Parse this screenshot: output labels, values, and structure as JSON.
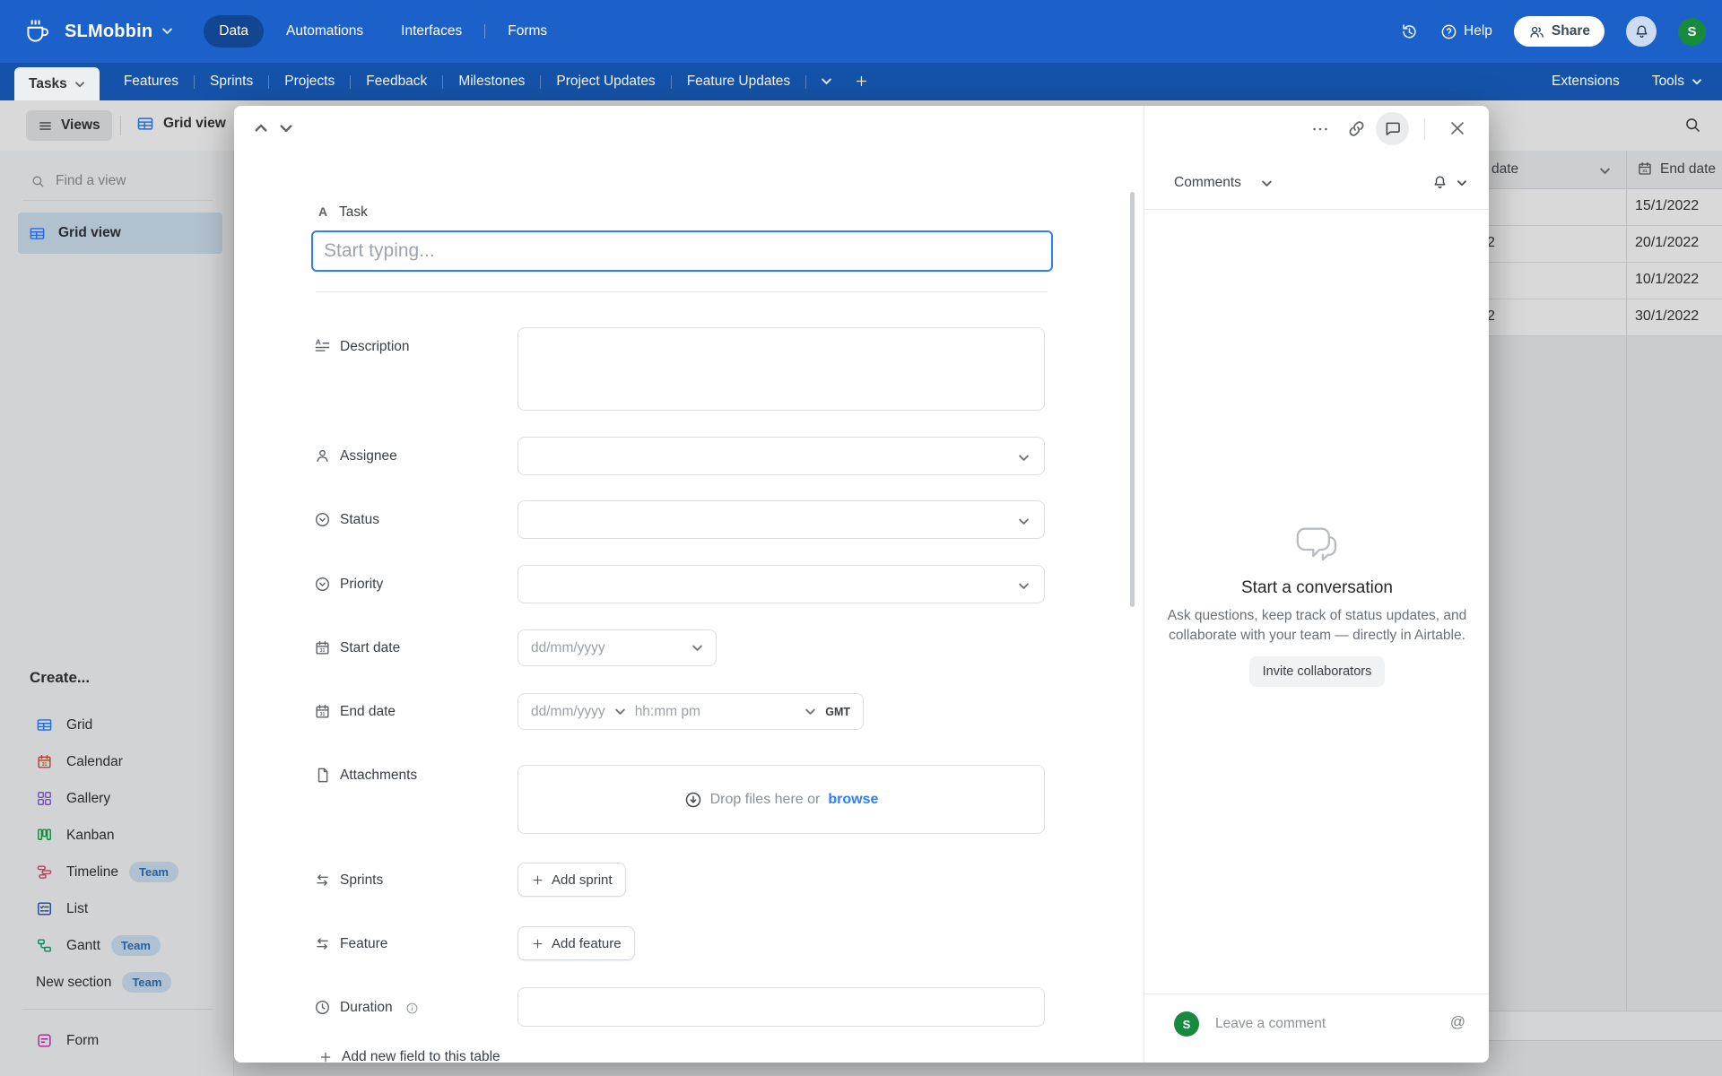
{
  "colors": {
    "topbar": "#1b61c9",
    "tabrow": "#1553ab",
    "accent": "#2d7ff9",
    "avatar": "#178a3d",
    "badge_bg": "#cfe3f6",
    "badge_text": "#3173b1"
  },
  "topbar": {
    "workspace": "SLMobbin",
    "nav": [
      {
        "label": "Data",
        "active": true
      },
      {
        "label": "Automations",
        "active": false
      },
      {
        "label": "Interfaces",
        "active": false
      },
      {
        "label": "Forms",
        "active": false
      }
    ],
    "help_label": "Help",
    "share_label": "Share",
    "avatar_initial": "S"
  },
  "tabbar": {
    "active_tab": "Tasks",
    "tabs": [
      "Features",
      "Sprints",
      "Projects",
      "Feedback",
      "Milestones",
      "Project Updates",
      "Feature Updates"
    ],
    "extensions_label": "Extensions",
    "tools_label": "Tools"
  },
  "toolbar": {
    "views_label": "Views",
    "view_name": "Grid view"
  },
  "sidebar": {
    "find_placeholder": "Find a view",
    "selected_view": "Grid view",
    "create_label": "Create...",
    "team_badge": "Team",
    "create_items": [
      {
        "label": "Grid",
        "color": "#2d7ff9",
        "team": false
      },
      {
        "label": "Calendar",
        "color": "#d94f29",
        "team": false
      },
      {
        "label": "Gallery",
        "color": "#8b63d2",
        "team": false
      },
      {
        "label": "Kanban",
        "color": "#18a146",
        "team": false
      },
      {
        "label": "Timeline",
        "color": "#d84a6b",
        "team": true
      },
      {
        "label": "List",
        "color": "#2750ae",
        "team": false
      },
      {
        "label": "Gantt",
        "color": "#1d9a6c",
        "team": true
      },
      {
        "label": "New section",
        "color": "",
        "team": true
      }
    ],
    "form_label": "Form"
  },
  "bg_table": {
    "col1_header": "date",
    "col2_header": "End date",
    "rows": [
      {
        "start_partial": "",
        "end": "15/1/2022"
      },
      {
        "start_partial": "2",
        "end": "20/1/2022"
      },
      {
        "start_partial": "",
        "end": "10/1/2022"
      },
      {
        "start_partial": "2",
        "end": "30/1/2022"
      }
    ]
  },
  "modal": {
    "task_label": "Task",
    "task_placeholder": "Start typing...",
    "description_label": "Description",
    "assignee_label": "Assignee",
    "status_label": "Status",
    "priority_label": "Priority",
    "start_date_label": "Start date",
    "end_date_label": "End date",
    "date_placeholder": "dd/mm/yyyy",
    "time_placeholder": "hh:mm pm",
    "timezone_label": "GMT",
    "attachments_label": "Attachments",
    "drop_text": "Drop files here or",
    "browse_label": "browse",
    "sprints_label": "Sprints",
    "add_sprint_label": "Add sprint",
    "feature_label": "Feature",
    "add_feature_label": "Add feature",
    "duration_label": "Duration",
    "add_field_label": "Add new field to this table"
  },
  "comments": {
    "header": "Comments",
    "empty_title": "Start a conversation",
    "empty_body": "Ask questions, keep track of status updates, and collaborate with your team — directly in Airtable.",
    "invite_label": "Invite collaborators",
    "composer_placeholder": "Leave a comment",
    "at_symbol": "@",
    "avatar_initial": "S"
  }
}
